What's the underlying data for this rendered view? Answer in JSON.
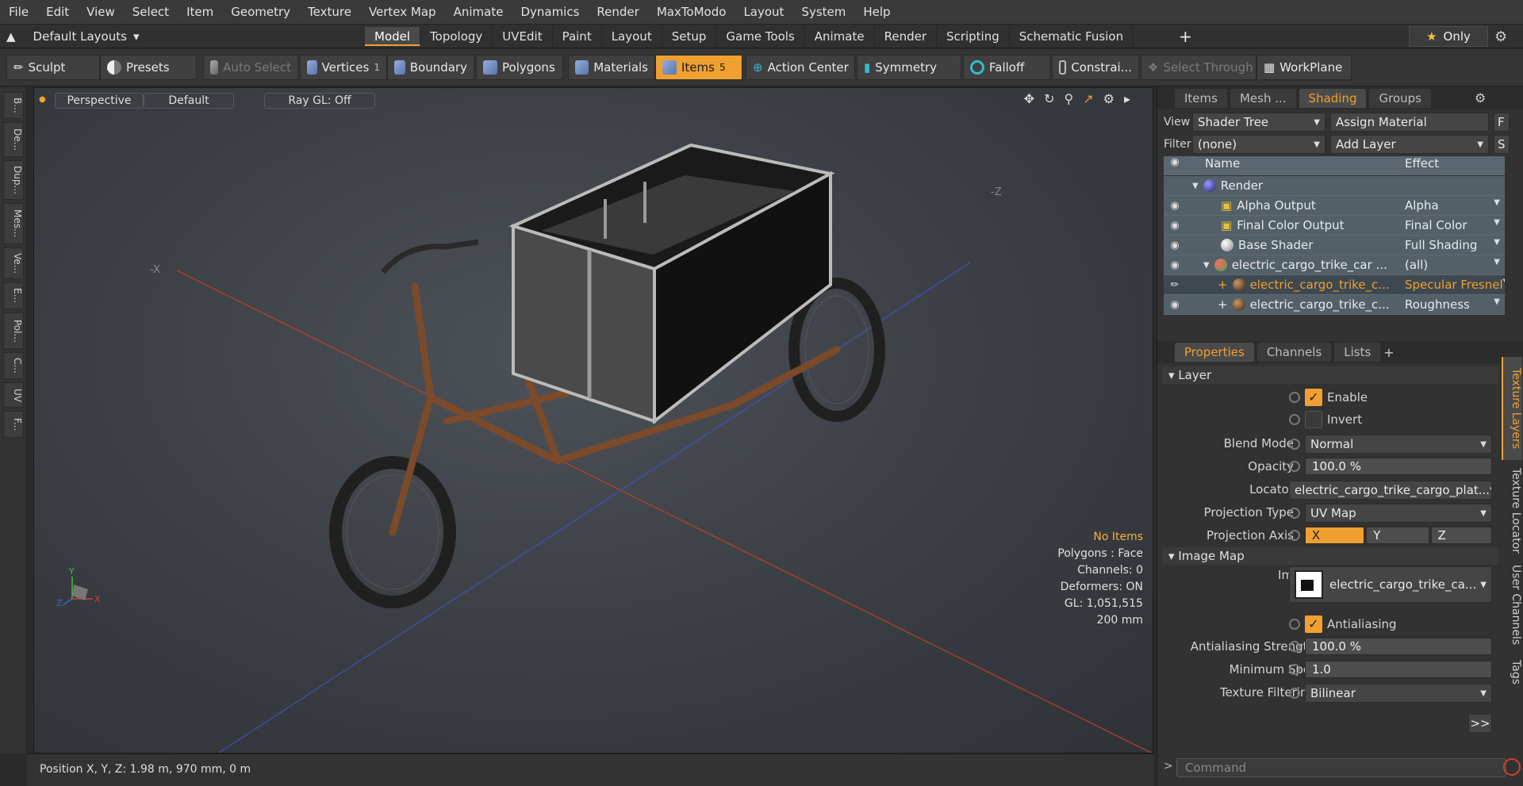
{
  "menu": [
    "File",
    "Edit",
    "View",
    "Select",
    "Item",
    "Geometry",
    "Texture",
    "Vertex Map",
    "Animate",
    "Dynamics",
    "Render",
    "MaxToModo",
    "Layout",
    "System",
    "Help"
  ],
  "layout": {
    "name": "Default Layouts",
    "tabs": [
      "Model",
      "Topology",
      "UVEdit",
      "Paint",
      "Layout",
      "Setup",
      "Game Tools",
      "Animate",
      "Render",
      "Scripting",
      "Schematic Fusion"
    ],
    "active_tab": "Model",
    "only": "Only"
  },
  "toolbar": {
    "sculpt": "Sculpt",
    "presets": "Presets",
    "auto_select": "Auto Select",
    "vertices": "Vertices",
    "vertices_count": "1",
    "boundary": "Boundary",
    "polygons": "Polygons",
    "materials": "Materials",
    "items": "Items",
    "items_count": "5",
    "action_center": "Action Center",
    "symmetry": "Symmetry",
    "falloff": "Falloff",
    "constrain": "Constrai...",
    "select_through": "Select Through",
    "workplane": "WorkPlane"
  },
  "leftstrip": [
    "B...",
    "De...",
    "Dup...",
    "Mes...",
    "Ve...",
    "E...",
    "Pol...",
    "C...",
    "UV",
    "F..."
  ],
  "viewport": {
    "perspective": "Perspective",
    "default": "Default",
    "raygl": "Ray GL: Off",
    "axis_neg_x": "-X",
    "axis_neg_z": "-Z",
    "info": {
      "no_items": "No Items",
      "polygons": "Polygons : Face",
      "channels": "Channels: 0",
      "deformers": "Deformers: ON",
      "gl": "GL: 1,051,515",
      "size": "200 mm"
    }
  },
  "status": {
    "position": "Position X, Y, Z:   1.98 m, 970 mm, 0 m"
  },
  "shading": {
    "tabs": [
      "Items",
      "Mesh ...",
      "Shading",
      "Groups"
    ],
    "active": "Shading",
    "view_label": "View",
    "view_value": "Shader Tree",
    "assign": "Assign Material",
    "f": "F",
    "filter_label": "Filter",
    "filter_value": "(none)",
    "add_layer": "Add Layer",
    "s": "S",
    "col_name": "Name",
    "col_effect": "Effect",
    "rows": [
      {
        "name": "Render",
        "effect": ""
      },
      {
        "name": "Alpha Output",
        "effect": "Alpha"
      },
      {
        "name": "Final Color Output",
        "effect": "Final Color"
      },
      {
        "name": "Base Shader",
        "effect": "Full Shading"
      },
      {
        "name": "electric_cargo_trike_car ...",
        "effect": "(all)"
      },
      {
        "name": "electric_cargo_trike_c...",
        "effect": "Specular Fresnel"
      },
      {
        "name": "electric_cargo_trike_c...",
        "effect": "Roughness"
      }
    ]
  },
  "props": {
    "tabs": [
      "Properties",
      "Channels",
      "Lists"
    ],
    "active": "Properties",
    "section_layer": "Layer",
    "enable": "Enable",
    "invert": "Invert",
    "blend_label": "Blend Mode",
    "blend": "Normal",
    "opacity_label": "Opacity",
    "opacity": "100.0 %",
    "locator_label": "Locator",
    "locator": "electric_cargo_trike_cargo_plat...",
    "proj_type_label": "Projection Type",
    "proj_type": "UV Map",
    "proj_axis_label": "Projection Axis",
    "axes": [
      "X",
      "Y",
      "Z"
    ],
    "section_image": "Image Map",
    "image_label": "Image",
    "image": "electric_cargo_trike_ca...",
    "antialiasing": "Antialiasing",
    "aa_strength_label": "Antialiasing Strength",
    "aa_strength": "100.0 %",
    "min_spot_label": "Minimum Spot",
    "min_spot": "1.0",
    "tex_filter_label": "Texture Filtering",
    "tex_filter": "Bilinear",
    "more": ">>",
    "side_tabs": [
      "Texture Layers",
      "Texture Locator",
      "User Channels",
      "Tags"
    ],
    "command_placeholder": "Command"
  }
}
